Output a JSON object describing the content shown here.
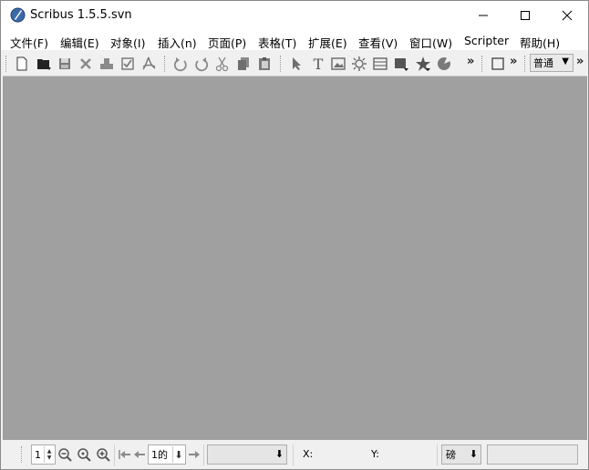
{
  "window": {
    "title": "Scribus 1.5.5.svn",
    "controls": [
      "minimize-icon",
      "maximize-icon",
      "close-icon"
    ]
  },
  "menu": {
    "items": [
      "文件(F)",
      "编辑(E)",
      "对象(I)",
      "插入(n)",
      "页面(P)",
      "表格(T)",
      "扩展(E)",
      "查看(V)",
      "窗口(W)",
      "Scripter",
      "帮助(H)"
    ]
  },
  "toolbar": {
    "file_tools": [
      "new-document-icon",
      "open-folder-icon",
      "save-icon",
      "close-document-icon",
      "print-icon",
      "preflight-check-icon",
      "export-pdf-icon"
    ],
    "edit_tools": [
      "undo-icon",
      "redo-icon",
      "cut-icon",
      "copy-icon",
      "paste-icon"
    ],
    "item_tools": [
      "select-arrow-icon",
      "text-frame-icon",
      "image-frame-icon",
      "render-frame-icon",
      "table-icon",
      "shape-icon",
      "polygon-star-icon",
      "arc-icon"
    ],
    "overflow": "»",
    "preview_mode": "普通"
  },
  "workspace": {
    "background": "#a0a0a0"
  },
  "statusbar": {
    "zoom_value": "1",
    "page_value": "1的",
    "layer_value": "",
    "x_label": "X:",
    "y_label": "Y:",
    "unit_value": "磅"
  }
}
